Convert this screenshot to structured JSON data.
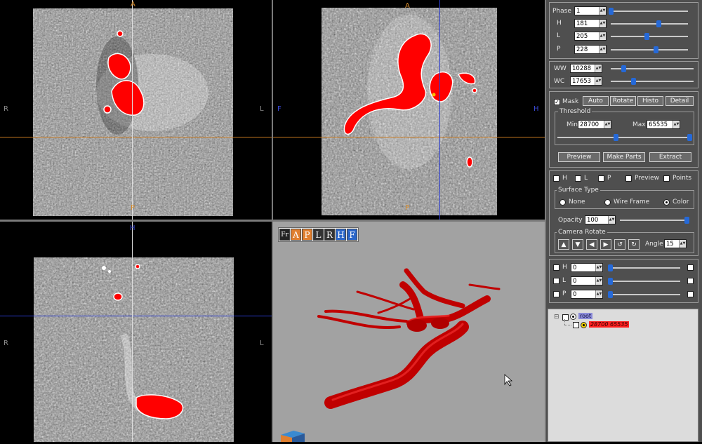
{
  "views": {
    "axial": {
      "top": "A",
      "bottom": "P",
      "left": "R",
      "right": "L"
    },
    "coronal": {
      "top": "A",
      "bottom": "P",
      "left": "F",
      "right": "H"
    },
    "sagittal": {
      "top": "H",
      "left": "R",
      "right": "L"
    }
  },
  "toolbar3d": {
    "fr": "Fr",
    "buttons": [
      "A",
      "P",
      "L",
      "R",
      "H",
      "F"
    ]
  },
  "colors": {
    "mask": "#ff0000",
    "orange_line": "#c97a20",
    "blue_line": "#2a3bd0",
    "slider_thumb": "#2569d8",
    "label_highlight": "#ff2020"
  },
  "panel": {
    "phase": {
      "label": "Phase",
      "value": "1",
      "slider": 0.0
    },
    "h": {
      "label": "H",
      "value": "181",
      "slider": 0.62
    },
    "l": {
      "label": "L",
      "value": "205",
      "slider": 0.46
    },
    "p": {
      "label": "P",
      "value": "228",
      "slider": 0.58
    },
    "ww": {
      "label": "WW",
      "value": "10288",
      "slider": 0.15
    },
    "wc": {
      "label": "WC",
      "value": "17653",
      "slider": 0.27
    },
    "mask": {
      "label": "Mask",
      "checked": true,
      "buttons": [
        "Auto",
        "Rotate",
        "Histo",
        "Detail"
      ]
    },
    "threshold": {
      "legend": "Threshold",
      "min_label": "Min",
      "min_value": "28700",
      "max_label": "Max",
      "max_value": "65535",
      "slider_min": 0.44,
      "slider_max": 1.0,
      "buttons": [
        "Preview",
        "Make Parts",
        "Extract"
      ]
    },
    "toggles": [
      "H",
      "L",
      "P",
      "Preview",
      "Points"
    ],
    "surface_type": {
      "legend": "Surface Type",
      "options": [
        "None",
        "Wire Frame",
        "Color"
      ],
      "selected": "Color"
    },
    "opacity": {
      "label": "Opacity",
      "value": "100",
      "slider": 1.0
    },
    "camera_rotate": {
      "legend": "Camera Rotate",
      "angle_label": "Angle",
      "angle_value": "15"
    },
    "clip": [
      {
        "label": "H",
        "value": "0",
        "slider": 0.0
      },
      {
        "label": "L",
        "value": "0",
        "slider": 0.0
      },
      {
        "label": "P",
        "value": "0",
        "slider": 0.0
      }
    ]
  },
  "tree": {
    "root": "root",
    "item": "28700 65535"
  }
}
